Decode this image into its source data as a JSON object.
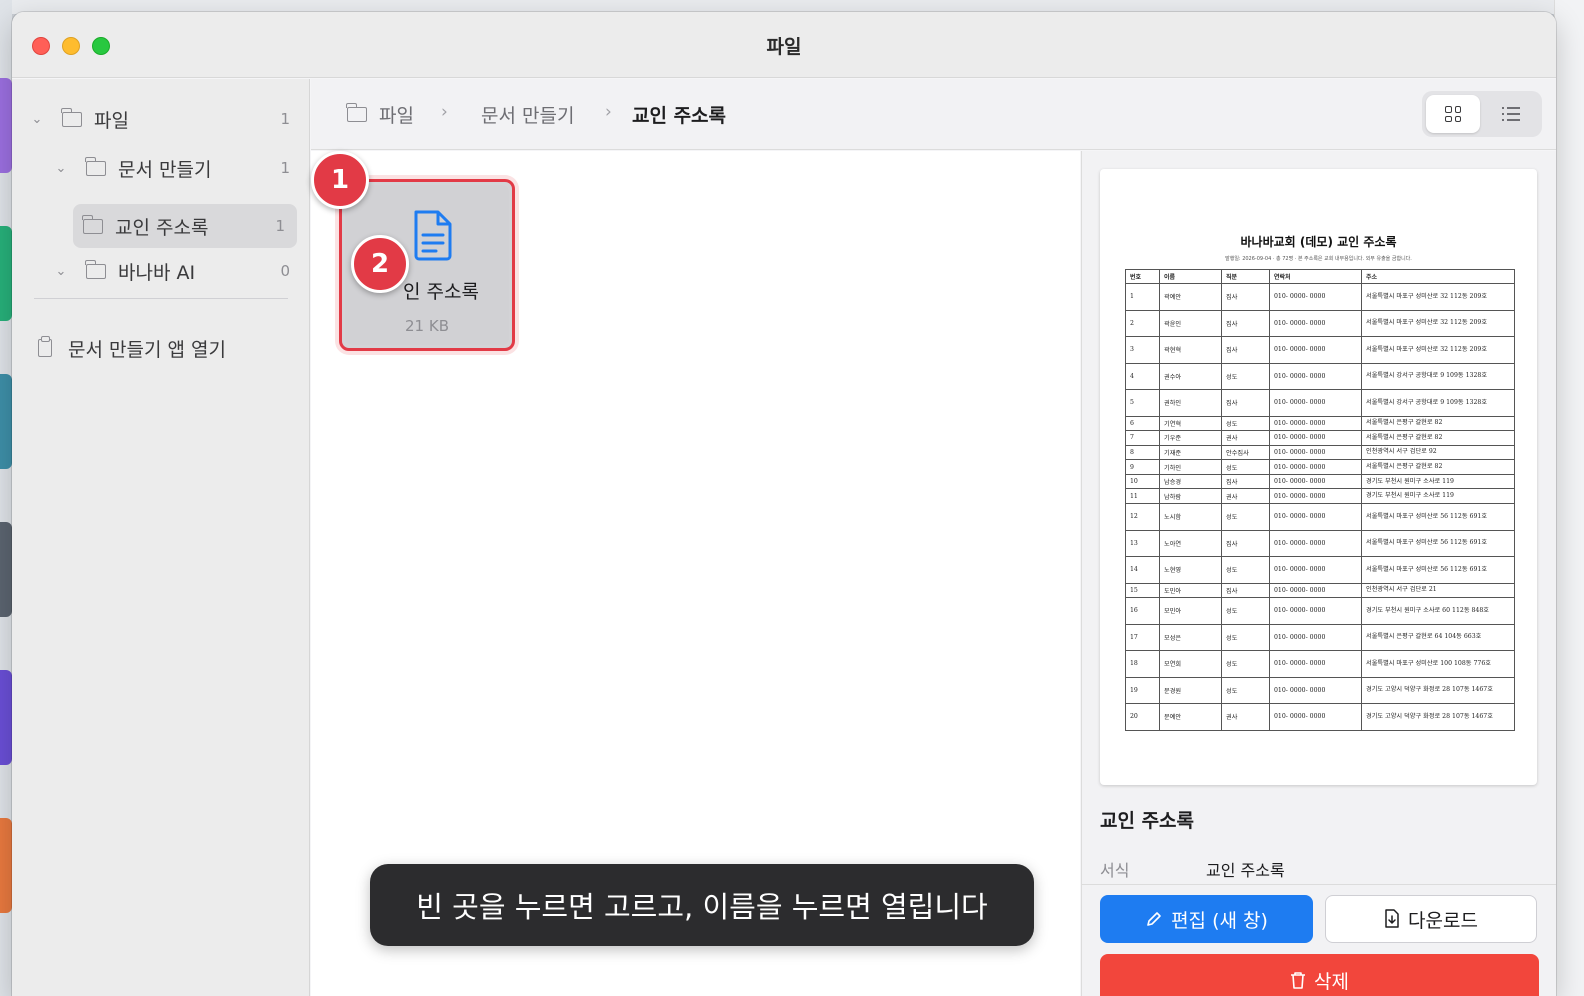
{
  "window": {
    "title": "파일"
  },
  "sidebar": {
    "items": [
      {
        "label": "파일",
        "count": "1"
      },
      {
        "label": "문서 만들기",
        "count": "1"
      },
      {
        "label": "교인 주소록",
        "count": "1"
      },
      {
        "label": "바나바 AI",
        "count": "0"
      }
    ],
    "open_app": "문서 만들기 앱 열기"
  },
  "breadcrumb": [
    "파일",
    "문서 만들기",
    "교인 주소록"
  ],
  "file": {
    "name": "교인 주소록",
    "visible_name": "인 주소록",
    "size": "21 KB"
  },
  "badges": [
    "1",
    "2"
  ],
  "toast": "빈 곳을 누르면 고르고, 이름을 누르면 열립니다",
  "preview": {
    "name": "교인 주소록",
    "format_label": "서식",
    "format_value": "교인 주소록",
    "edit_label": "편집 (새 창)",
    "download_label": "다운로드",
    "delete_label": "삭제"
  },
  "document": {
    "title": "바나바교회 (데모) 교인 주소록",
    "subtitle": "발행일: 2026-09-04 · 총 72명 · 본 주소록은 교회 내부용입니다. 외부 유출을 금합니다.",
    "headers": [
      "번호",
      "이름",
      "직분",
      "연락처",
      "주소"
    ],
    "rows": [
      [
        "1",
        "곽예안",
        "집사",
        "010- 0000- 0000",
        "서울특별시 마포구 성미산로 32 112동 209호"
      ],
      [
        "2",
        "곽윤인",
        "집사",
        "010- 0000- 0000",
        "서울특별시 마포구 성미산로 32 112동 209호"
      ],
      [
        "3",
        "곽현혁",
        "집사",
        "010- 0000- 0000",
        "서울특별시 마포구 성미산로 32 112동 209호"
      ],
      [
        "4",
        "권수아",
        "성도",
        "010- 0000- 0000",
        "서울특별시 강서구 공항대로 9 109동 1328호"
      ],
      [
        "5",
        "권하인",
        "집사",
        "010- 0000- 0000",
        "서울특별시 강서구 공항대로 9 109동 1328호"
      ],
      [
        "6",
        "기연혁",
        "성도",
        "010- 0000- 0000",
        "서울특별시 은평구 갈현로 82"
      ],
      [
        "7",
        "기우준",
        "권사",
        "010- 0000- 0000",
        "서울특별시 은평구 갈현로 82"
      ],
      [
        "8",
        "기재준",
        "안수집사",
        "010- 0000- 0000",
        "인천광역시 서구 검단로 92"
      ],
      [
        "9",
        "기하인",
        "성도",
        "010- 0000- 0000",
        "서울특별시 은평구 갈현로 82"
      ],
      [
        "10",
        "남승경",
        "집사",
        "010- 0000- 0000",
        "경기도 부천시 원미구 소사로 119"
      ],
      [
        "11",
        "남하람",
        "권사",
        "010- 0000- 0000",
        "경기도 부천시 원미구 소사로 119"
      ],
      [
        "12",
        "노시함",
        "성도",
        "010- 0000- 0000",
        "서울특별시 마포구 성미산로 56 112동 691호"
      ],
      [
        "13",
        "노아연",
        "집사",
        "010- 0000- 0000",
        "서울특별시 마포구 성미산로 56 112동 691호"
      ],
      [
        "14",
        "노현영",
        "성도",
        "010- 0000- 0000",
        "서울특별시 마포구 성미산로 56 112동 691호"
      ],
      [
        "15",
        "도민아",
        "집사",
        "010- 0000- 0000",
        "인천광역시 서구 검단로 21"
      ],
      [
        "16",
        "모민아",
        "성도",
        "010- 0000- 0000",
        "경기도 부천시 원미구 소사로 60 112동 848호"
      ],
      [
        "17",
        "모성은",
        "성도",
        "010- 0000- 0000",
        "서울특별시 은평구 갈현로 64 104동 663호"
      ],
      [
        "18",
        "모연희",
        "성도",
        "010- 0000- 0000",
        "서울특별시 마포구 성미산로 100 108동 776호"
      ],
      [
        "19",
        "문경원",
        "성도",
        "010- 0000- 0000",
        "경기도 고양시 덕양구 화정로 28 107동 1467호"
      ],
      [
        "20",
        "문예안",
        "권사",
        "010- 0000- 0000",
        "경기도 고양시 덕양구 화정로 28 107동 1467호"
      ]
    ]
  }
}
